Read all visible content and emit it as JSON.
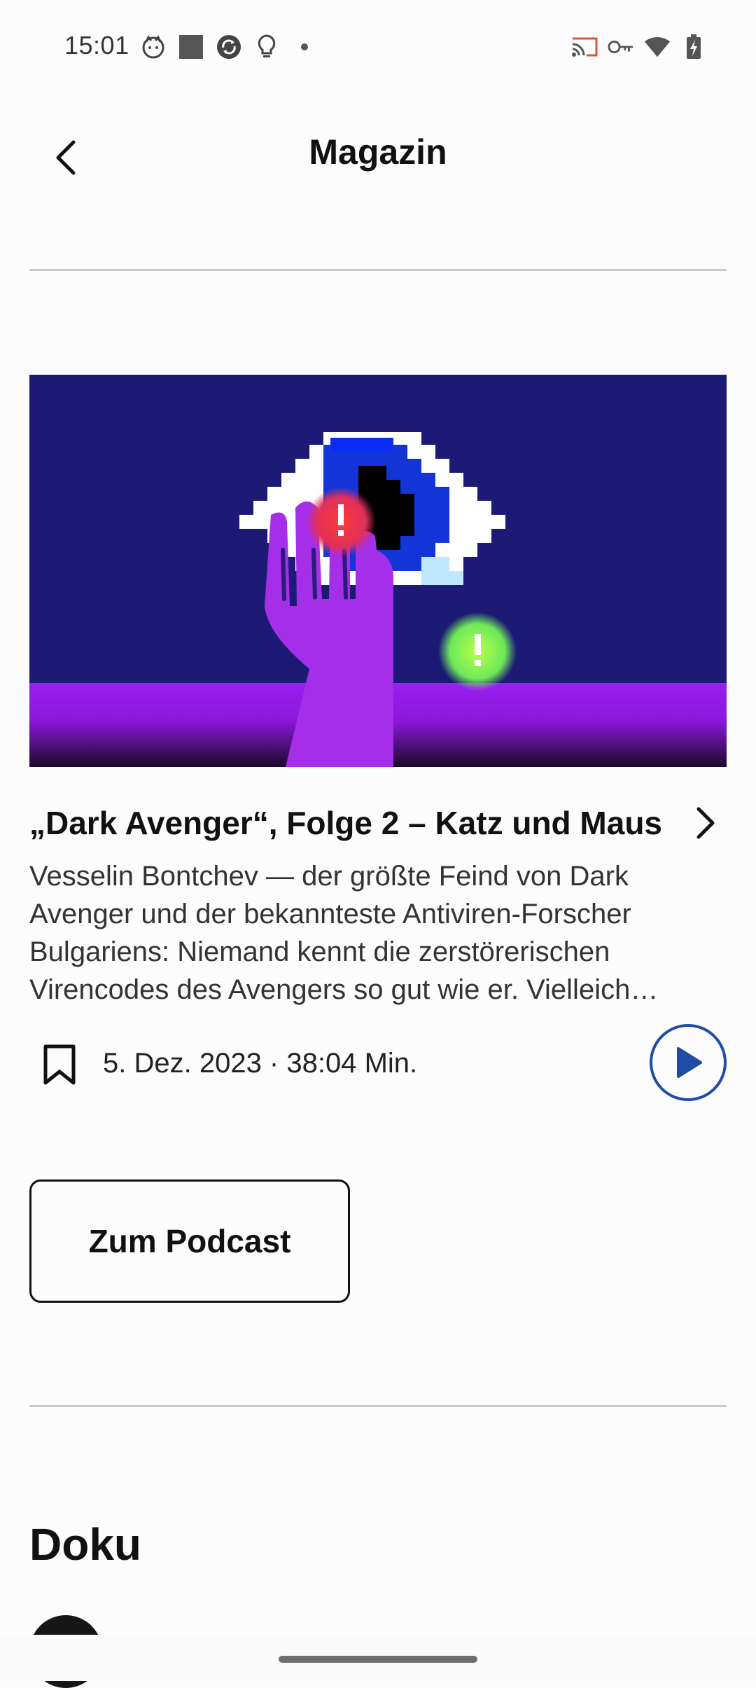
{
  "status_bar": {
    "time": "15:01",
    "left_icons": [
      "cat-face-icon",
      "square-icon",
      "sync-icon",
      "lightbulb-icon",
      "dot-icon"
    ],
    "right_icons": [
      "cast-icon",
      "vpn-key-icon",
      "wifi-icon",
      "battery-charging-icon"
    ]
  },
  "app_bar": {
    "title": "Magazin",
    "back_icon": "chevron-left-icon"
  },
  "episode": {
    "title": "„Dark Avenger“, Folge 2 – Katz und Maus",
    "description": "Vesselin Bontchev — der größte Feind von Dark Avenger und der bekannteste Antiviren-Forscher Bulgariens: Niemand kennt die zerstörerischen Virencodes des Avengers so gut wie er. Vielleich…",
    "meta": "5. Dez. 2023 · 38:04 Min.",
    "bookmark_icon": "bookmark-icon",
    "play_icon": "play-icon",
    "accent_color": "#1e4ca6"
  },
  "podcast_button": {
    "label": "Zum Podcast"
  },
  "section": {
    "title": "Doku"
  },
  "hero_colors": {
    "background": "#1c1a75",
    "ground": "#9b1ff0",
    "hand": "#a32ce8"
  }
}
